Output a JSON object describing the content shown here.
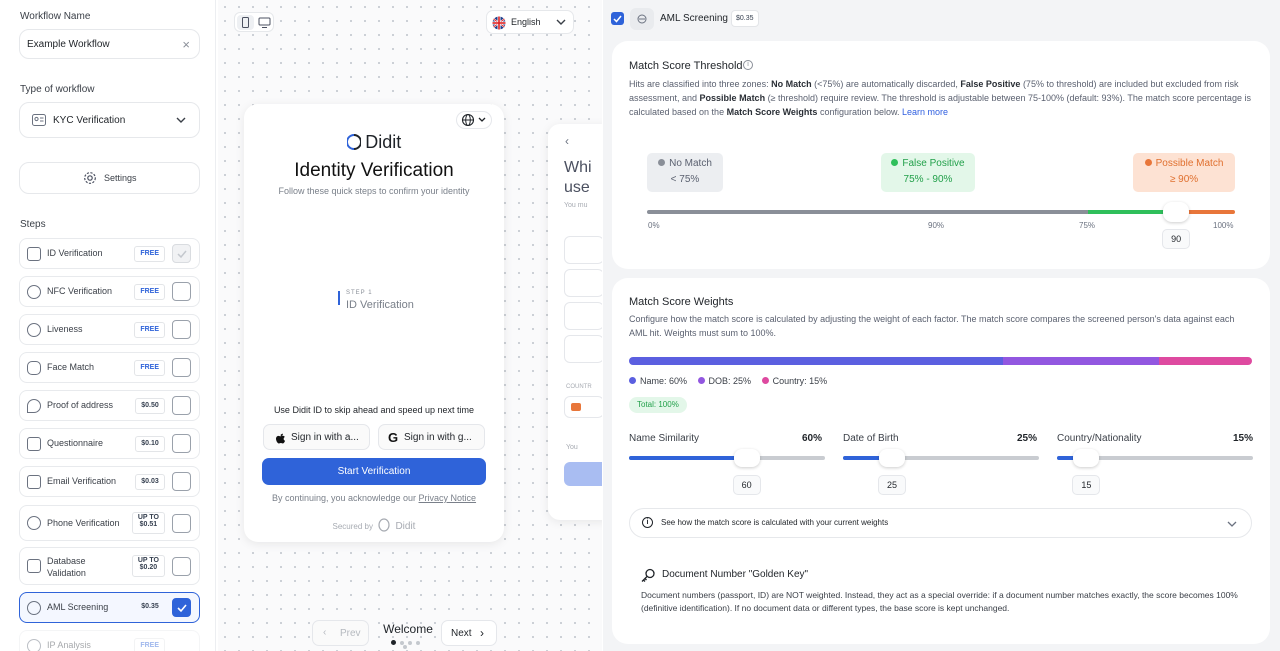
{
  "sidebar": {
    "workflow_name_label": "Workflow Name",
    "workflow_name_value": "Example Workflow",
    "type_label": "Type of workflow",
    "type_value": "KYC Verification",
    "settings_label": "Settings",
    "steps_label": "Steps",
    "steps": [
      {
        "name": "ID Verification",
        "price": "FREE",
        "checked": true,
        "disabled": true
      },
      {
        "name": "NFC Verification",
        "price": "FREE",
        "checked": false
      },
      {
        "name": "Liveness",
        "price": "FREE",
        "checked": false
      },
      {
        "name": "Face Match",
        "price": "FREE",
        "checked": false
      },
      {
        "name": "Proof of address",
        "price": "$0.50",
        "checked": false
      },
      {
        "name": "Questionnaire",
        "price": "$0.10",
        "checked": false
      },
      {
        "name": "Email Verification",
        "price": "$0.03",
        "checked": false
      },
      {
        "name": "Phone Verification",
        "price_top": "UP TO",
        "price_bottom": "$0.51",
        "checked": false
      },
      {
        "name_top": "Database",
        "name_bottom": "Validation",
        "price_top": "UP TO",
        "price_bottom": "$0.20",
        "checked": false
      },
      {
        "name": "AML Screening",
        "price": "$0.35",
        "checked": true,
        "active": true
      },
      {
        "name": "IP Analysis",
        "price": "FREE",
        "checked": false
      }
    ]
  },
  "preview": {
    "language": "English",
    "brand": "Didit",
    "title": "Identity Verification",
    "subtitle": "Follow these quick steps to confirm your identity",
    "step_kicker": "STEP 1",
    "step_name": "ID Verification",
    "skip_text": "Use Didit ID to skip ahead and speed up next time",
    "apple_button": "Sign in with a...",
    "google_button": "Sign in with g...",
    "start_button": "Start Verification",
    "consent_prefix": "By continuing, you acknowledge our ",
    "consent_link": "Privacy Notice",
    "secured_by": "Secured by",
    "secured_brand": "Didit",
    "next_screen_title_1": "Whi",
    "next_screen_title_2": "use",
    "next_screen_sub": "You mu",
    "next_screen_country": "COUNTR",
    "next_screen_foot": "You",
    "nav_prev": "Prev",
    "nav_title": "Welcome",
    "nav_next": "Next",
    "page_dots_total": 5,
    "page_dots_active": 1
  },
  "aml": {
    "header_title": "AML Screening",
    "header_price": "$0.35",
    "threshold": {
      "title": "Match Score Threshold",
      "desc_1": "Hits are classified into three zones: ",
      "no_match_b": "No Match",
      "desc_2": " (<75%) are automatically discarded, ",
      "false_positive_b": "False Positive",
      "desc_3": " (75% to threshold) are included but excluded from risk assessment, and ",
      "possible_match_b": "Possible Match",
      "desc_4": " (≥ threshold) require review. The threshold is adjustable between 75-100% (default: 93%). The match score percentage is calculated based on the ",
      "weights_b": "Match Score Weights",
      "desc_5": " configuration below. ",
      "learn_more": "Learn more",
      "zones": [
        {
          "name": "No Match",
          "range": "< 75%",
          "color": "#8a8f98",
          "bg": "#eceef1",
          "text": "#5b6170"
        },
        {
          "name": "False Positive",
          "range": "75% - 90%",
          "color": "#2fbf5b",
          "bg": "#e3f7e9",
          "text": "#22a04a"
        },
        {
          "name": "Possible Match",
          "range": "≥ 90%",
          "color": "#e8763a",
          "bg": "#fde2d3",
          "text": "#e0702f"
        }
      ],
      "scale_labels": [
        "0%",
        "90%",
        "75%",
        "100%"
      ],
      "scale_min": 75,
      "scale_max": 100,
      "value": 90,
      "value_label": "90"
    },
    "weights": {
      "title": "Match Score Weights",
      "desc": "Configure how the match score is calculated by adjusting the weight of each factor. The match score compares the screened person's data against each AML hit. Weights must sum to 100%.",
      "segments": [
        {
          "label": "Name: 60%",
          "value": 60,
          "color": "#5b5fe0"
        },
        {
          "label": "DOB: 25%",
          "value": 25,
          "color": "#9257e0"
        },
        {
          "label": "Country: 15%",
          "value": 15,
          "color": "#de4aa0"
        }
      ],
      "total_badge": "Total: 100%",
      "sliders": [
        {
          "label": "Name Similarity",
          "pct": "60%",
          "value": 60,
          "value_label": "60"
        },
        {
          "label": "Date of Birth",
          "pct": "25%",
          "value": 25,
          "value_label": "25"
        },
        {
          "label": "Country/Nationality",
          "pct": "15%",
          "value": 15,
          "value_label": "15"
        }
      ],
      "explain": "See how the match score is calculated with your current weights",
      "golden_title": "Document Number \"Golden Key\"",
      "golden_desc": "Document numbers (passport, ID) are NOT weighted. Instead, they act as a special override: if a document number matches exactly, the score becomes 100% (definitive identification). If no document data or different types, the base score is kept unchanged."
    }
  },
  "colors": {
    "accent": "#2f63d9",
    "primary_button": "#2f63d9"
  }
}
